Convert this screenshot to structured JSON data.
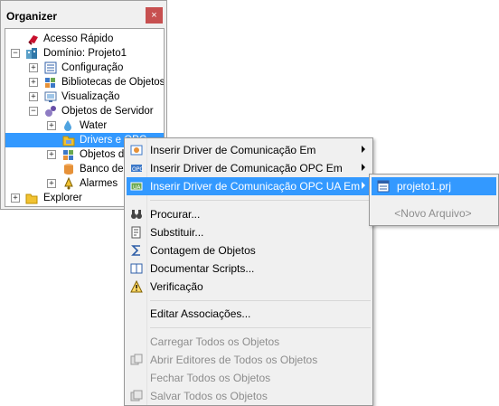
{
  "organizer": {
    "title": "Organizer",
    "close": "×",
    "tree": [
      {
        "label": "Acesso Rápido",
        "icon": "quick-access-icon"
      },
      {
        "label": "Domínio: Projeto1",
        "icon": "domain-icon",
        "expander": "−"
      },
      {
        "label": "Configuração",
        "icon": "config-icon",
        "expander": "+"
      },
      {
        "label": "Bibliotecas de Objetos",
        "icon": "libraries-icon",
        "expander": "+"
      },
      {
        "label": "Visualização",
        "icon": "visualization-icon",
        "expander": "+"
      },
      {
        "label": "Objetos de Servidor",
        "icon": "server-objects-icon",
        "expander": "−"
      },
      {
        "label": "Water",
        "icon": "water-icon",
        "expander": "+"
      },
      {
        "label": "Drivers e OPC",
        "icon": "drivers-folder-icon"
      },
      {
        "label": "Objetos de",
        "icon": "objects-icon",
        "expander": "+"
      },
      {
        "label": "Banco de D",
        "icon": "database-icon"
      },
      {
        "label": "Alarmes",
        "icon": "alarms-icon",
        "expander": "+"
      },
      {
        "label": "Explorer",
        "icon": "explorer-folder-icon",
        "expander": "+"
      }
    ]
  },
  "menu": {
    "items": [
      {
        "label": "Inserir Driver de Comunicação Em",
        "icon": "driver-icon",
        "submenu": true
      },
      {
        "label": "Inserir Driver de Comunicação OPC Em",
        "icon": "opc-icon",
        "submenu": true
      },
      {
        "label": "Inserir Driver de Comunicação OPC UA Em",
        "icon": "opc-ua-icon",
        "submenu": true
      },
      {
        "label": "Procurar...",
        "icon": "binoculars-icon"
      },
      {
        "label": "Substituir...",
        "icon": "replace-icon"
      },
      {
        "label": "Contagem de Objetos",
        "icon": "sigma-icon"
      },
      {
        "label": "Documentar Scripts...",
        "icon": "book-icon"
      },
      {
        "label": "Verificação",
        "icon": "warning-icon"
      },
      {
        "label": "Editar Associações..."
      },
      {
        "label": "Carregar Todos os Objetos"
      },
      {
        "label": "Abrir Editores de Todos os Objetos",
        "icon": "open-editors-icon"
      },
      {
        "label": "Fechar Todos os Objetos"
      },
      {
        "label": "Salvar Todos os Objetos",
        "icon": "save-all-icon"
      }
    ]
  },
  "submenu": {
    "project": "projeto1.prj",
    "new_file": "<Novo Arquivo>"
  },
  "colors": {
    "highlight": "#3399ff",
    "disabled": "#8d8d8d"
  }
}
